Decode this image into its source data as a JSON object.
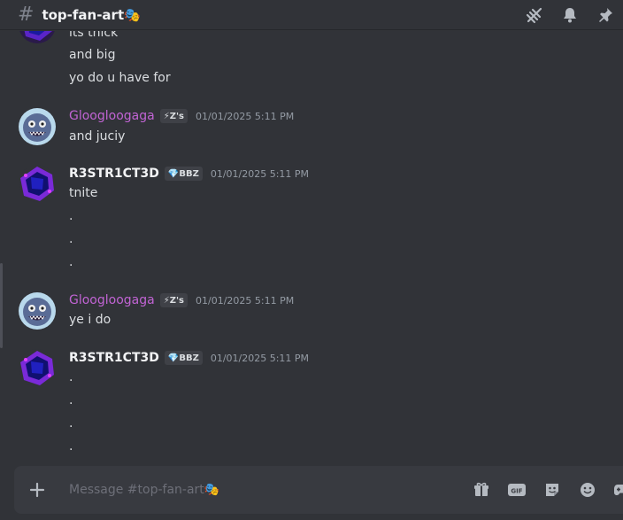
{
  "channel": {
    "hash": "#",
    "name": "top-fan-art🎭"
  },
  "header_icons": [
    "threads-icon",
    "bell-icon",
    "pin-icon"
  ],
  "messages": [
    {
      "lines": [
        "its thick",
        "and big",
        "yo do u have for"
      ]
    },
    {
      "user": "Gloogloogaga",
      "tag": "⚡Z's",
      "timestamp": "01/01/2025 5:11 PM",
      "lines": [
        "and juciy"
      ]
    },
    {
      "user": "R3STR1CT3D",
      "tag": "💎BBZ",
      "timestamp": "01/01/2025 5:11 PM",
      "lines": [
        "tnite",
        ".",
        ".",
        "."
      ]
    },
    {
      "user": "Gloogloogaga",
      "tag": "⚡Z's",
      "timestamp": "01/01/2025 5:11 PM",
      "lines": [
        "ye i do"
      ]
    },
    {
      "user": "R3STR1CT3D",
      "tag": "💎BBZ",
      "timestamp": "01/01/2025 5:11 PM",
      "lines": [
        ".",
        ".",
        ".",
        "."
      ]
    }
  ],
  "composer": {
    "placeholder": "Message #top-fan-art🎭",
    "icons": [
      "gift-icon",
      "gif-icon",
      "sticker-icon",
      "emoji-icon",
      "game-icon"
    ]
  },
  "colors": {
    "bg": "#313338",
    "purple_name": "#c164d4",
    "composer_bg": "#383a40"
  }
}
